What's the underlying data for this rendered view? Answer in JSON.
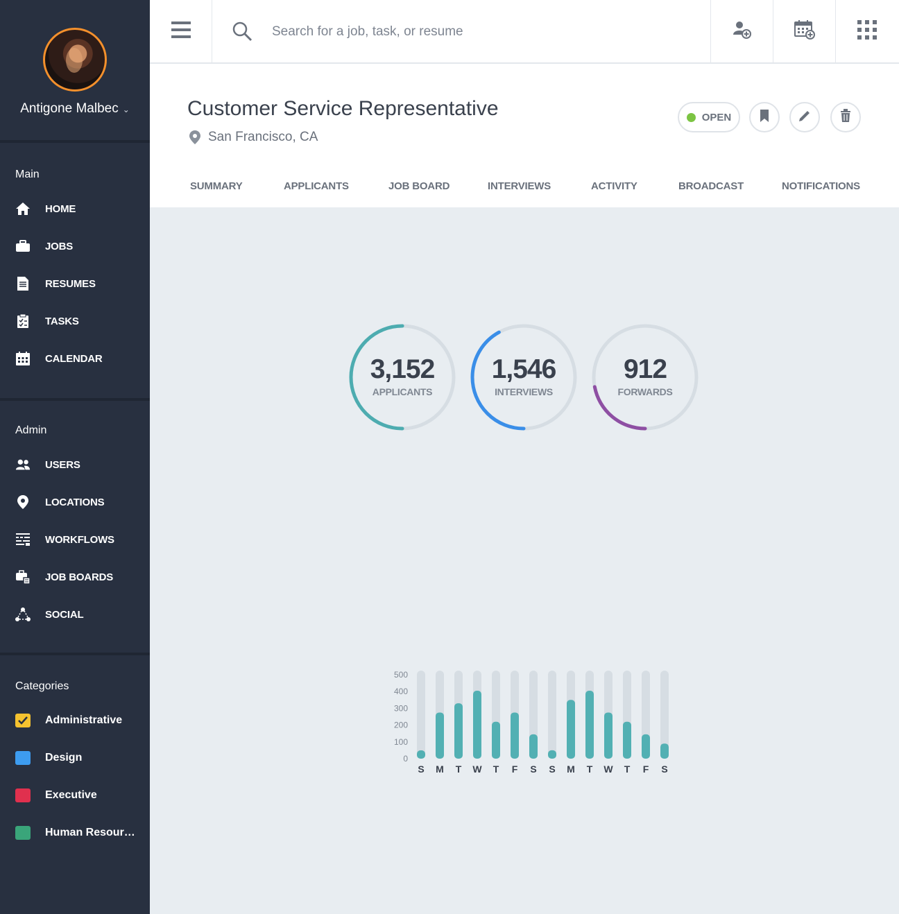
{
  "user": {
    "name": "Antigone Malbec"
  },
  "sidebar": {
    "main_title": "Main",
    "main_items": [
      {
        "label": "HOME",
        "icon": "home-icon"
      },
      {
        "label": "JOBS",
        "icon": "briefcase-icon"
      },
      {
        "label": "RESUMES",
        "icon": "document-icon"
      },
      {
        "label": "TASKS",
        "icon": "clipboard-icon"
      },
      {
        "label": "CALENDAR",
        "icon": "calendar-icon"
      }
    ],
    "admin_title": "Admin",
    "admin_items": [
      {
        "label": "USERS",
        "icon": "users-icon"
      },
      {
        "label": "LOCATIONS",
        "icon": "location-pin-icon"
      },
      {
        "label": "WORKFLOWS",
        "icon": "workflow-icon"
      },
      {
        "label": "JOB BOARDS",
        "icon": "job-boards-icon"
      },
      {
        "label": "SOCIAL",
        "icon": "social-network-icon"
      }
    ],
    "categories_title": "Categories",
    "categories": [
      {
        "label": "Administrative",
        "color": "#f5c22f",
        "checked": true
      },
      {
        "label": "Design",
        "color": "#3d9cf0",
        "checked": false
      },
      {
        "label": "Executive",
        "color": "#e0304e",
        "checked": false
      },
      {
        "label": "Human Resourc...",
        "color": "#3aa57a",
        "checked": false
      }
    ]
  },
  "search": {
    "placeholder": "Search for a job, task, or resume"
  },
  "job": {
    "title": "Customer Service Representative",
    "location": "San Francisco, CA",
    "status": "OPEN",
    "status_color": "#7cc443"
  },
  "tabs": [
    "SUMMARY",
    "APPLICANTS",
    "JOB BOARD",
    "INTERVIEWS",
    "ACTIVITY",
    "BROADCAST",
    "NOTIFICATIONS"
  ],
  "stats": [
    {
      "value": "3,152",
      "label": "APPLICANTS",
      "progress": 0.5,
      "color": "#4dacb0"
    },
    {
      "value": "1,546",
      "label": "INTERVIEWS",
      "progress": 0.42,
      "color": "#3a8ee8"
    },
    {
      "value": "912",
      "label": "FORWARDS",
      "progress": 0.22,
      "color": "#8e4fa3"
    }
  ],
  "chart_data": {
    "type": "bar",
    "categories": [
      "S",
      "M",
      "T",
      "W",
      "T",
      "F",
      "S",
      "S",
      "M",
      "T",
      "W",
      "T",
      "F",
      "S"
    ],
    "values": [
      25,
      275,
      330,
      405,
      220,
      275,
      145,
      50,
      350,
      405,
      275,
      220,
      145,
      90
    ],
    "ylim": [
      0,
      500
    ],
    "yticks": [
      0,
      100,
      200,
      300,
      400,
      500
    ],
    "bar_color": "#52b0b3",
    "track_color": "#d6dde3",
    "grid": false
  }
}
